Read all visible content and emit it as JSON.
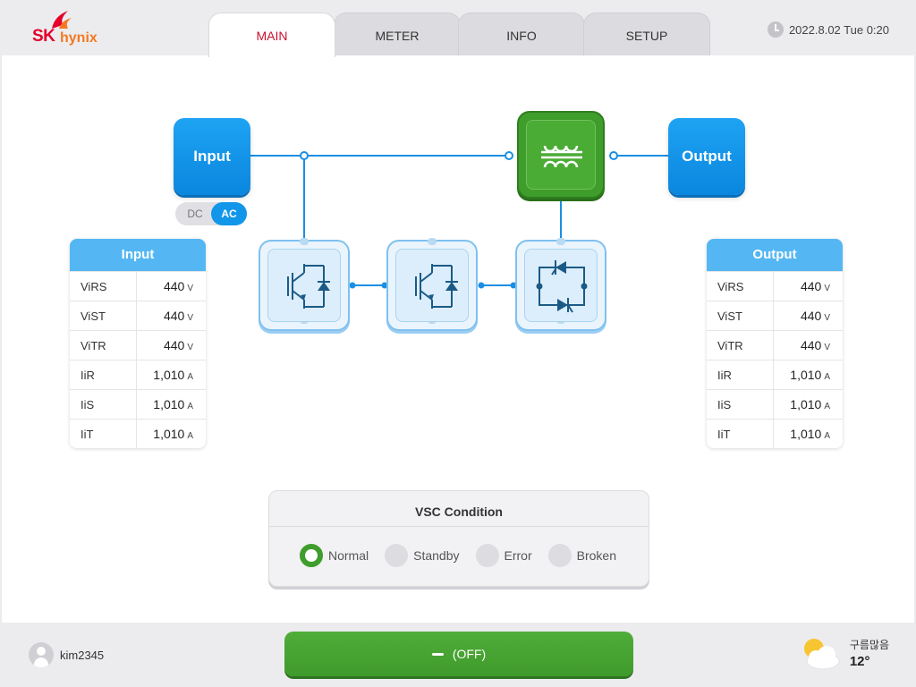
{
  "brand": {
    "sk": "SK",
    "hynix": "hynix"
  },
  "tabs": [
    "MAIN",
    "METER",
    "INFO",
    "SETUP"
  ],
  "datetime": "2022.8.02 Tue 0:20",
  "diagram": {
    "input_label": "Input",
    "output_label": "Output",
    "dc_label": "DC",
    "ac_label": "AC",
    "ac_selected": true
  },
  "input_table": {
    "title": "Input",
    "rows": [
      {
        "key": "ViRS",
        "value": "440",
        "unit": "V"
      },
      {
        "key": "ViST",
        "value": "440",
        "unit": "V"
      },
      {
        "key": "ViTR",
        "value": "440",
        "unit": "V"
      },
      {
        "key": "IiR",
        "value": "1,010",
        "unit": "A"
      },
      {
        "key": "IiS",
        "value": "1,010",
        "unit": "A"
      },
      {
        "key": "IiT",
        "value": "1,010",
        "unit": "A"
      }
    ]
  },
  "output_table": {
    "title": "Output",
    "rows": [
      {
        "key": "ViRS",
        "value": "440",
        "unit": "V"
      },
      {
        "key": "ViST",
        "value": "440",
        "unit": "V"
      },
      {
        "key": "ViTR",
        "value": "440",
        "unit": "V"
      },
      {
        "key": "IiR",
        "value": "1,010",
        "unit": "A"
      },
      {
        "key": "IiS",
        "value": "1,010",
        "unit": "A"
      },
      {
        "key": "IiT",
        "value": "1,010",
        "unit": "A"
      }
    ]
  },
  "vsc": {
    "title": "VSC Condition",
    "options": [
      "Normal",
      "Standby",
      "Error",
      "Broken"
    ],
    "selected": "Normal"
  },
  "footer": {
    "user": "kim2345",
    "power_button": "(OFF)",
    "weather_condition": "구름많음",
    "temperature": "12°"
  },
  "colors": {
    "accent_blue": "#1196ea",
    "green": "#3f9d2c",
    "active_tab": "#c8102e",
    "brand_red": "#e4002b",
    "brand_orange": "#f47920"
  }
}
